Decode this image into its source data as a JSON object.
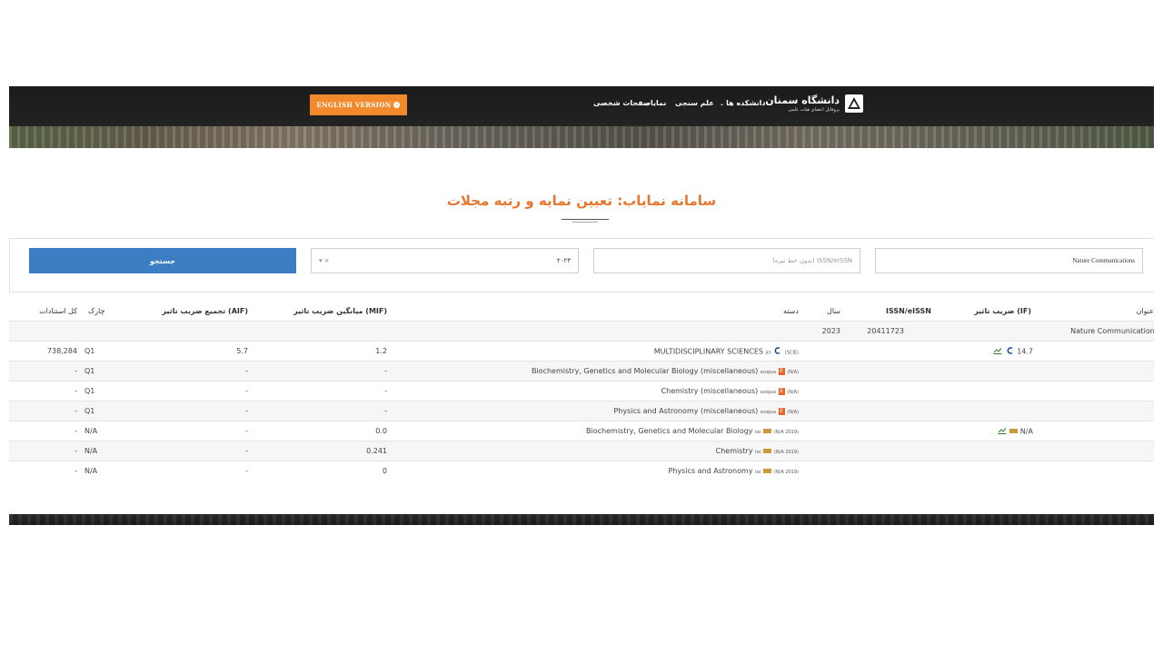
{
  "header": {
    "english_button": "ENGLISH VERSION",
    "nav": [
      "دانشکده ها",
      "علم سنجی",
      "نمایاب",
      "صفحات شخصی"
    ],
    "logo_name": "دانشگاه سمنان",
    "logo_subtitle": "پروفایل اعضای هیات علمی"
  },
  "page_title": "سامانه نمایاب: تعیین نمایه و رتبه مجلات",
  "search": {
    "journal_value": "Nature Communications",
    "issn_placeholder": "ISSN/eISSN (بدون خط تیره)",
    "year_value": "۲۰۲۳",
    "clear_symbol": "×",
    "dropdown_symbol": "▾",
    "search_button": "جستجو"
  },
  "table": {
    "headers": {
      "title": "عنوان",
      "if": "ضریب تاثیر (IF)",
      "issn": "ISSN/eISSN",
      "year": "سال",
      "category": "دسته",
      "mif": "میانگین ضریب تاثیر (MIF)",
      "aif": "تجمیع ضریب تاثیر (AIF)",
      "quartile": "چارک",
      "citations": "کل استنادات"
    },
    "journal_row": {
      "title": "Nature Communications",
      "issn": "20411723",
      "year": "2023"
    },
    "rows": [
      {
        "if": "14.7",
        "category": "MULTIDISCIPLINARY SCIENCES",
        "source": "jcr",
        "tag": "(SCIE)",
        "mif": "1.2",
        "aif": "5.7",
        "quartile": "Q1",
        "citations": "738,284"
      },
      {
        "if": "",
        "category": "Biochemistry, Genetics and Molecular Biology (miscellaneous)",
        "source": "scopus",
        "tag": "(N/A)",
        "mif": "-",
        "aif": "-",
        "quartile": "Q1",
        "citations": "-"
      },
      {
        "if": "",
        "category": "Chemistry (miscellaneous)",
        "source": "scopus",
        "tag": "(N/A)",
        "mif": "-",
        "aif": "-",
        "quartile": "Q1",
        "citations": "-"
      },
      {
        "if": "",
        "category": "Physics and Astronomy (miscellaneous)",
        "source": "scopus",
        "tag": "(N/A)",
        "mif": "-",
        "aif": "-",
        "quartile": "Q1",
        "citations": "-"
      },
      {
        "if": "N/A",
        "category": "Biochemistry, Genetics and Molecular Biology",
        "source": "isc",
        "tag": "(N/A 2019)",
        "mif": "0.0",
        "aif": "-",
        "quartile": "N/A",
        "citations": "-"
      },
      {
        "if": "",
        "category": "Chemistry",
        "source": "isc",
        "tag": "(N/A 2019)",
        "mif": "0.241",
        "aif": "-",
        "quartile": "N/A",
        "citations": "-"
      },
      {
        "if": "",
        "category": "Physics and Astronomy",
        "source": "isc",
        "tag": "(N/A 2019)",
        "mif": "0",
        "aif": "-",
        "quartile": "N/A",
        "citations": "-"
      }
    ]
  },
  "colors": {
    "accent": "#e8772e",
    "button": "#3b7ec3",
    "english_button": "#f28a2d"
  }
}
